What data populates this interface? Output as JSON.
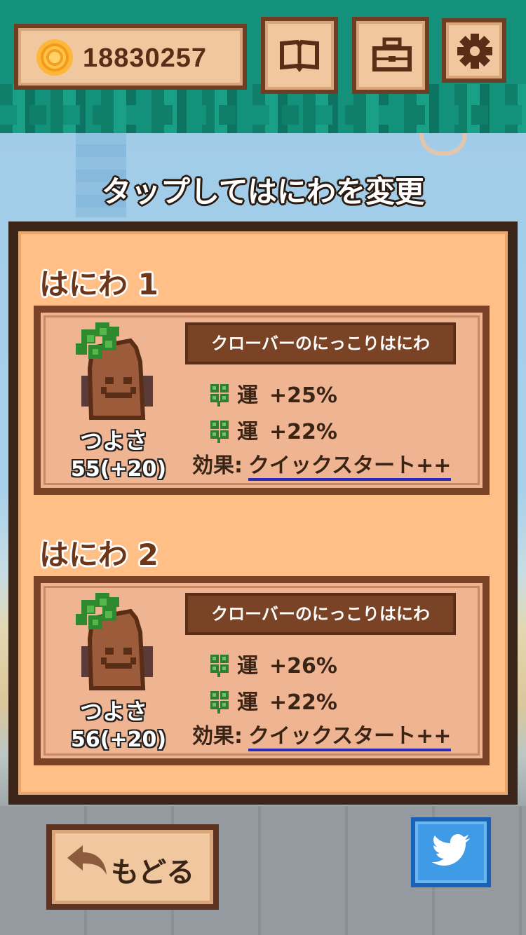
{
  "header": {
    "coins": "18830257",
    "book_icon": "book-icon",
    "toolbox_icon": "toolbox-icon",
    "settings_icon": "gear-icon",
    "coin_icon": "coin-icon"
  },
  "title": "タップしてはにわを変更",
  "haniwa_slots": [
    {
      "heading": "はにわ 1",
      "name": "クローバーのにっこりはにわ",
      "power_label": "つよさ",
      "power_value": "55(+20)",
      "stats": [
        {
          "icon": "clover-icon",
          "key": "運",
          "value": "+25%"
        },
        {
          "icon": "clover-icon",
          "key": "運",
          "value": "+22%"
        }
      ],
      "effect_label": "効果:",
      "effect_value": "クイックスタート++"
    },
    {
      "heading": "はにわ 2",
      "name": "クローバーのにっこりはにわ",
      "power_label": "つよさ",
      "power_value": "56(+20)",
      "stats": [
        {
          "icon": "clover-icon",
          "key": "運",
          "value": "+26%"
        },
        {
          "icon": "clover-icon",
          "key": "運",
          "value": "+22%"
        }
      ],
      "effect_label": "効果:",
      "effect_value": "クイックスタート++"
    }
  ],
  "footer": {
    "back_label": "もどる",
    "back_icon": "back-arrow-icon",
    "share_icon": "twitter-icon"
  },
  "colors": {
    "panel_bg": "#ffbf86",
    "frame_dark": "#3b2418",
    "name_plate": "#7b4325",
    "link_underline": "#2a2ab8",
    "twitter_blue": "#3f9be6"
  }
}
